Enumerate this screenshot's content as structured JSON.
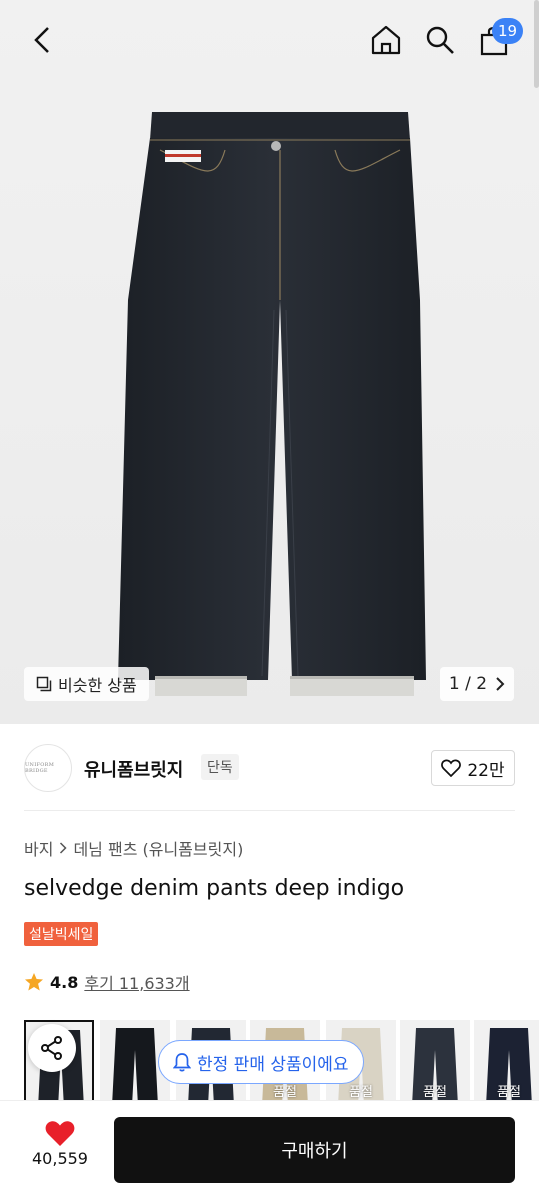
{
  "header": {
    "back_icon": "chevron-left-icon",
    "home_icon": "home-icon",
    "search_icon": "search-icon",
    "cart_icon": "shopping-bag-icon",
    "cart_count": "19"
  },
  "gallery": {
    "similar_label": "비슷한 상품",
    "pager": "1 / 2"
  },
  "brand": {
    "logo_text": "UNIFORM BRIDGE",
    "name": "유니폼브릿지",
    "tag": "단독",
    "likes": "22만"
  },
  "product": {
    "breadcrumb": [
      "바지",
      "데님 팬츠 (유니폼브릿지)"
    ],
    "title": "selvedge denim pants deep indigo",
    "sale_tag": "설날빅세일",
    "rating": "4.8",
    "reviews": "후기 11,633개"
  },
  "options": {
    "sold_out_label": "품절",
    "limited_label": "한정 판매 상품이에요"
  },
  "bottom": {
    "wish_count": "40,559",
    "buy_label": "구매하기"
  },
  "colors": {
    "cart_badge": "#3b82f6",
    "sale_tag": "#f0613d",
    "wish_heart": "#e8202a",
    "buy_button": "#111111",
    "limited_text": "#2563eb"
  }
}
